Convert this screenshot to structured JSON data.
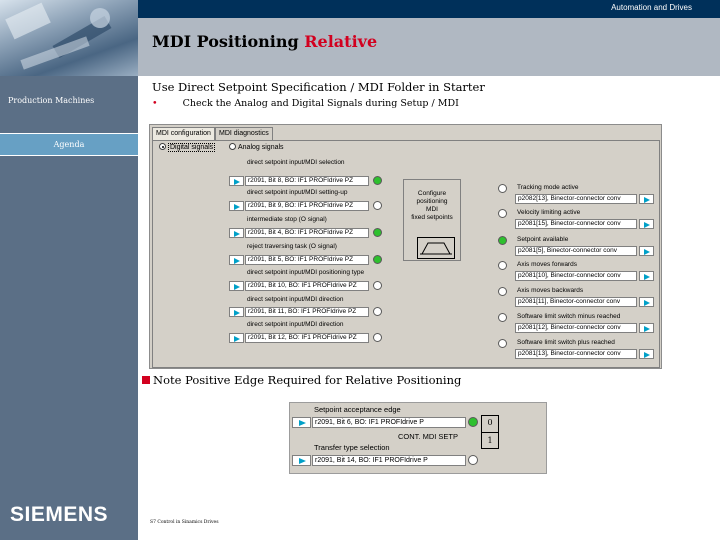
{
  "header": {
    "top_label": "Automation and Drives"
  },
  "sidebar": {
    "production_label": "Production Machines",
    "agenda_label": "Agenda"
  },
  "title": {
    "main": "MDI Positioning",
    "accent": "Relative"
  },
  "subheading": "Use Direct Setpoint Specification / MDI Folder in Starter",
  "bullet": {
    "marker": "•",
    "text": "Check the Analog and Digital Signals during Setup / MDI"
  },
  "screen": {
    "tabs": [
      "MDI configuration",
      "MDI diagnostics"
    ],
    "radios": [
      "Digital signals",
      "Analog signals"
    ],
    "left_rows": [
      {
        "label": "direct setpoint input/MDI selection",
        "field": "r2091, Bit 8, BO: IF1 PROFIdrive PZ",
        "led": "green"
      },
      {
        "label": "direct setpoint input/MDI setting-up",
        "field": "r2091, Bit 9, BO: IF1 PROFIdrive PZ",
        "led": "off"
      },
      {
        "label": "intermediate stop (O signal)",
        "field": "r2091, Bit 4, BO: IF1 PROFIdrive PZ",
        "led": "green"
      },
      {
        "label": "reject traversing task (O signal)",
        "field": "r2091, Bit 5, BO: IF1 PROFIdrive PZ",
        "led": "green"
      },
      {
        "label": "direct setpoint input/MDI positioning type",
        "field": "r2091, Bit 10, BO: IF1 PROFIdrive PZ",
        "led": "off"
      },
      {
        "label": "direct setpoint input/MDI direction",
        "field": "r2091, Bit 11, BO: IF1 PROFIdrive PZ",
        "led": "off"
      },
      {
        "label": "direct setpoint input/MDI direction",
        "field": "r2091, Bit 12, BO: IF1 PROFIdrive PZ",
        "led": "off"
      }
    ],
    "config": {
      "line1": "Configure",
      "line2": "positioning",
      "line3": "MDI",
      "line4": "fixed setpoints"
    },
    "right_rows": [
      {
        "label": "Tracking mode active",
        "field": "p2082[13], Binector-connector conv"
      },
      {
        "label": "Velocity limiting active",
        "field": "p2081[15], Binector-connector conv"
      },
      {
        "label": "Setpoint available",
        "field": "p2081[5], Binector-connector conv"
      },
      {
        "label": "Axis moves forwards",
        "field": "p2081[10], Binector-connector conv"
      },
      {
        "label": "Axis moves backwards",
        "field": "p2081[11], Binector-connector conv"
      },
      {
        "label": "Software limit switch minus reached",
        "field": "p2081[12], Binector-connector conv"
      },
      {
        "label": "Software limit switch plus reached",
        "field": "p2081[13], Binector-connector conv"
      }
    ]
  },
  "note": "Note Positive Edge Required for Relative Positioning",
  "edge_panel": {
    "label1": "Setpoint acceptance edge",
    "field1": "r2091, Bit 6, BO: IF1 PROFIdrive P",
    "cont_label": "CONT. MDI SETP",
    "label2": "Transfer type selection",
    "field2": "r2091, Bit 14, BO: IF1 PROFIdrive P",
    "flag_zero": "0",
    "flag_one": "1"
  },
  "brand": {
    "logo": "SIEMENS"
  },
  "footer": {
    "left": "S7 Control in Sinamics Drives"
  }
}
